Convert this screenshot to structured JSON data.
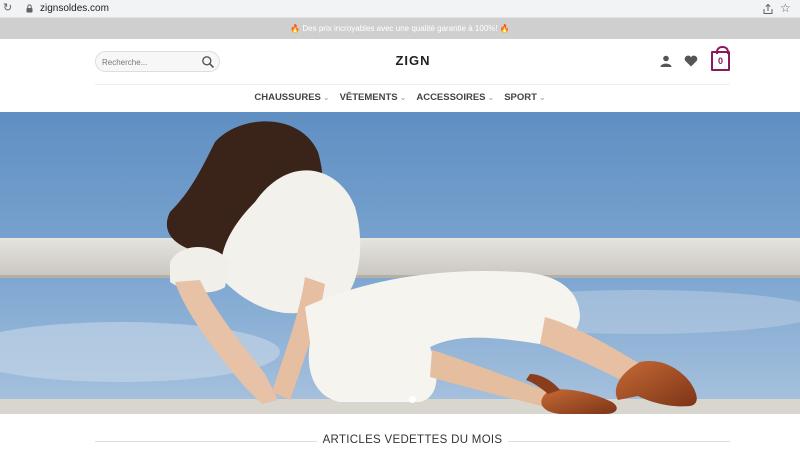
{
  "browser": {
    "url": "zignsoldes.com"
  },
  "announcement": {
    "text": "Des prix incroyables avec une qualité garantie à 100%!",
    "icon": "fire-icon"
  },
  "header": {
    "search_placeholder": "Recherche...",
    "logo": "ZIGN",
    "cart_count": "0",
    "accent_color": "#8b1a5c"
  },
  "nav": {
    "items": [
      {
        "label": "CHAUSSURES"
      },
      {
        "label": "VÊTEMENTS"
      },
      {
        "label": "ACCESSOIRES"
      },
      {
        "label": "SPORT"
      }
    ]
  },
  "hero": {
    "slides": 1,
    "active_slide": 1
  },
  "featured": {
    "title": "ARTICLES VEDETTES DU MOIS"
  }
}
